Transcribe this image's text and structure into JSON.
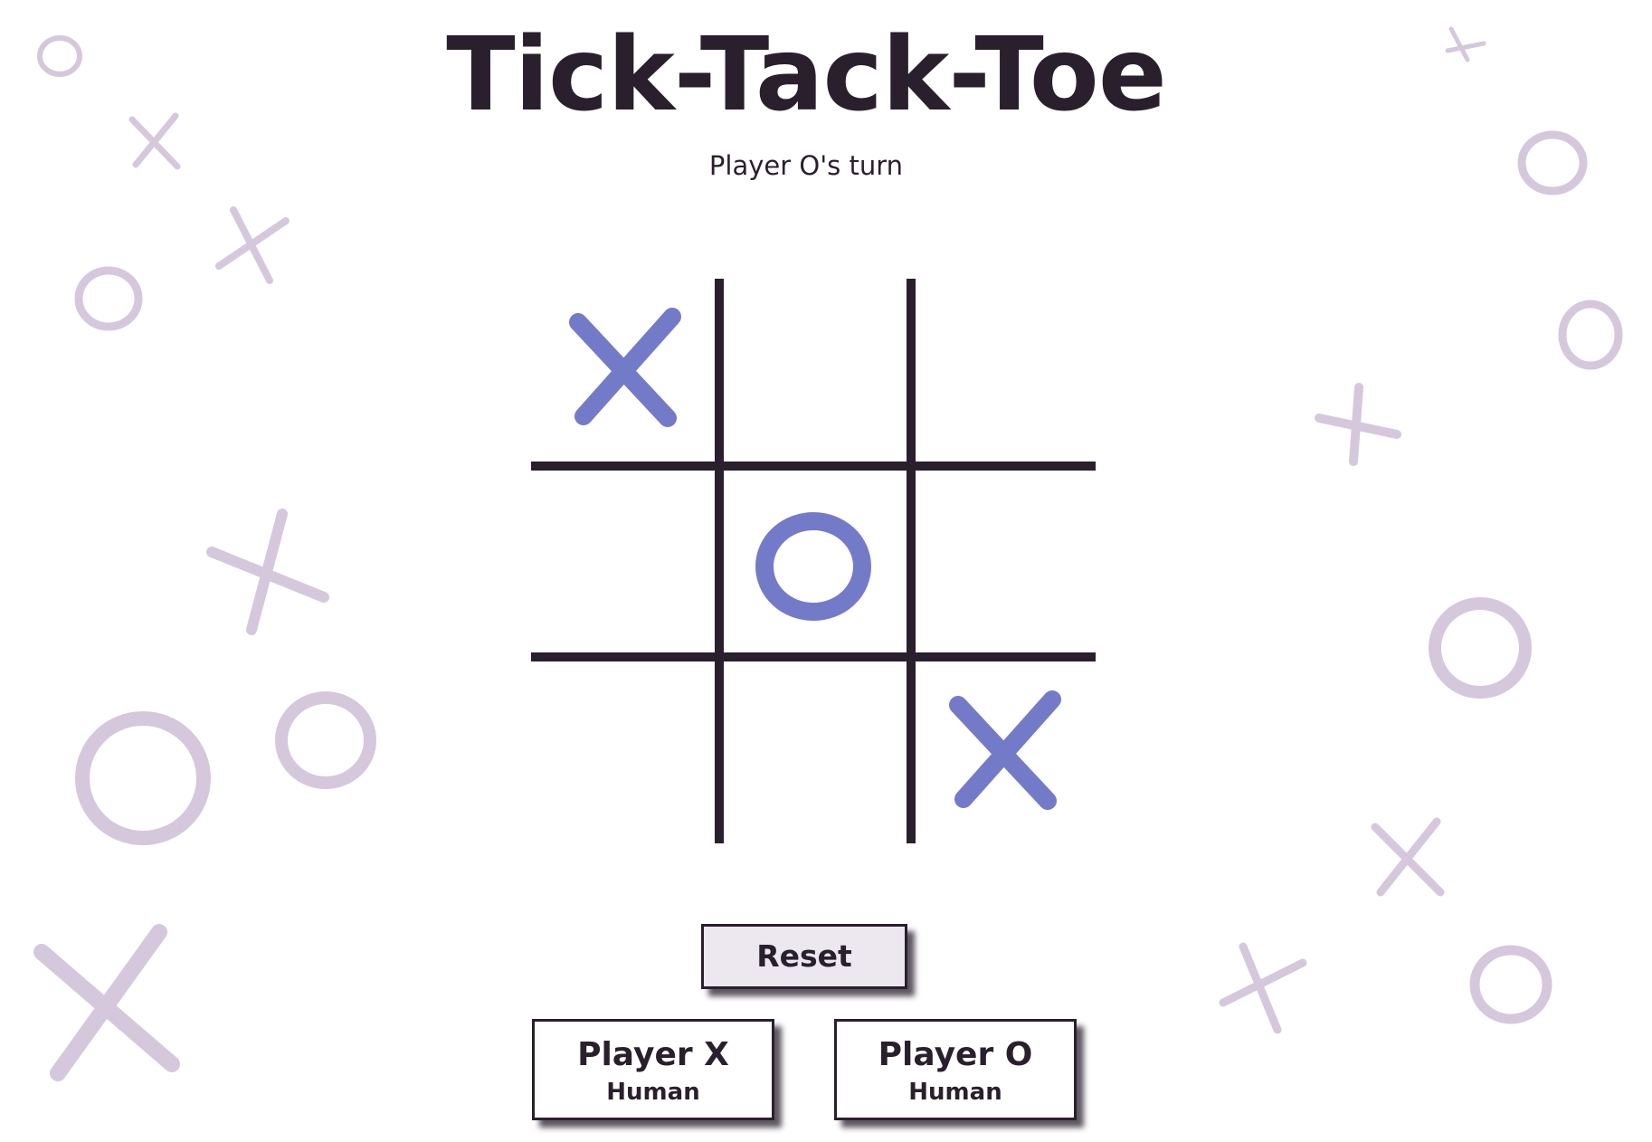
{
  "game": {
    "title": "Tick-Tack-Toe",
    "status": "Player O's turn",
    "board": [
      "X",
      "",
      "",
      "",
      "O",
      "",
      "",
      "",
      "X"
    ],
    "mark_color": "#737bc9",
    "grid_color": "#2a1f2d",
    "decor_color": "#d5c8dd"
  },
  "controls": {
    "reset_label": "Reset",
    "button_bg": "#ede7f0"
  },
  "players": [
    {
      "name": "Player X",
      "type": "Human"
    },
    {
      "name": "Player O",
      "type": "Human"
    }
  ]
}
